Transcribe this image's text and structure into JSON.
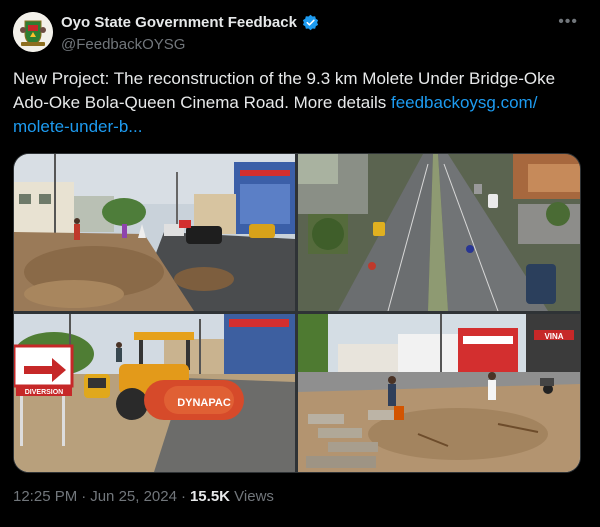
{
  "author": {
    "name": "Oyo State Government Feedback",
    "handle": "@FeedbackOYSG",
    "verified_icon": "verified-badge-icon",
    "avatar_icon": "state-crest-icon"
  },
  "tweet": {
    "text": "New Project: The reconstruction of the 9.3 km Molete Under Bridge-Oke Ado-Oke Bola-Queen Cinema Road. More details ",
    "link_text": "feedbackoysg.com/\nmolete-under-b..."
  },
  "media": {
    "sign_label": "DIVERSION",
    "roller_brand": "DYNAPAC",
    "shop_sign": "VINA"
  },
  "meta": {
    "time": "12:25 PM",
    "date": "Jun 25, 2024",
    "views_count": "15.5K",
    "views_label": "Views"
  },
  "colors": {
    "background": "#000000",
    "text": "#e7e9ea",
    "secondary": "#71767b",
    "link": "#1d9bf0"
  }
}
